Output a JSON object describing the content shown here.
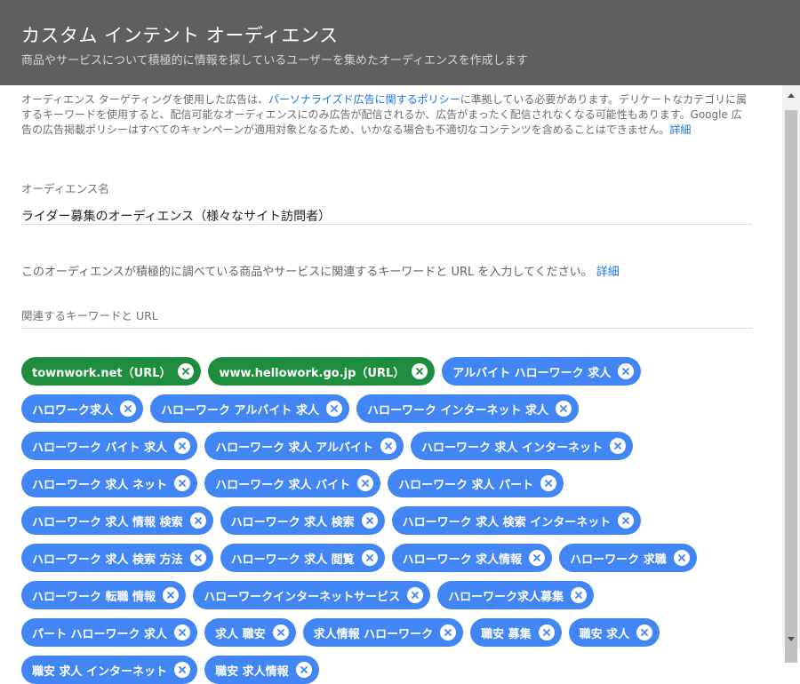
{
  "header": {
    "title": "カスタム インテント オーディエンス",
    "subtitle": "商品やサービスについて積極的に情報を探しているユーザーを集めたオーディエンスを作成します"
  },
  "notice": {
    "part1": "オーディエンス ターゲティングを使用した広告は、",
    "policy_link": "パーソナライズド広告に関するポリシー",
    "part2": "に準拠している必要があります。デリケートなカテゴリに属するキーワードを使用すると、配信可能なオーディエンスにのみ広告が配信されるか、広告がまったく配信されなくなる可能性もあります。Google 広告の広告掲載ポリシーはすべてのキャンペーンが適用対象となるため、いかなる場合も不適切なコンテンツを含めることはできません。",
    "details_link": "詳細"
  },
  "audience_name": {
    "label": "オーディエンス名",
    "value": "ライダー募集のオーディエンス（様々なサイト訪問者）"
  },
  "description": {
    "text": "このオーディエンスが積極的に調べている商品やサービスに関連するキーワードと URL を入力してください。",
    "details_link": "詳細"
  },
  "keywords_field": {
    "label": "関連するキーワードと URL"
  },
  "chips": [
    {
      "label": "townwork.net（URL）",
      "type": "url"
    },
    {
      "label": "www.hellowork.go.jp（URL）",
      "type": "url"
    },
    {
      "label": "アルバイト ハローワーク 求人",
      "type": "keyword"
    },
    {
      "label": "ハロワーク求人",
      "type": "keyword"
    },
    {
      "label": "ハローワーク アルバイト 求人",
      "type": "keyword"
    },
    {
      "label": "ハローワーク インターネット 求人",
      "type": "keyword"
    },
    {
      "label": "ハローワーク バイト 求人",
      "type": "keyword"
    },
    {
      "label": "ハローワーク 求人 アルバイト",
      "type": "keyword"
    },
    {
      "label": "ハローワーク 求人 インターネット",
      "type": "keyword"
    },
    {
      "label": "ハローワーク 求人 ネット",
      "type": "keyword"
    },
    {
      "label": "ハローワーク 求人 バイト",
      "type": "keyword"
    },
    {
      "label": "ハローワーク 求人 パート",
      "type": "keyword"
    },
    {
      "label": "ハローワーク 求人 情報 検索",
      "type": "keyword"
    },
    {
      "label": "ハローワーク 求人 検索",
      "type": "keyword"
    },
    {
      "label": "ハローワーク 求人 検索 インターネット",
      "type": "keyword"
    },
    {
      "label": "ハローワーク 求人 検索 方法",
      "type": "keyword"
    },
    {
      "label": "ハローワーク 求人 閲覧",
      "type": "keyword"
    },
    {
      "label": "ハローワーク 求人情報",
      "type": "keyword"
    },
    {
      "label": "ハローワーク 求職",
      "type": "keyword"
    },
    {
      "label": "ハローワーク 転職 情報",
      "type": "keyword"
    },
    {
      "label": "ハローワークインターネットサービス",
      "type": "keyword"
    },
    {
      "label": "ハローワーク求人募集",
      "type": "keyword"
    },
    {
      "label": "パート ハローワーク 求人",
      "type": "keyword"
    },
    {
      "label": "求人 職安",
      "type": "keyword"
    },
    {
      "label": "求人情報 ハローワーク",
      "type": "keyword"
    },
    {
      "label": "職安 募集",
      "type": "keyword"
    },
    {
      "label": "職安 求人",
      "type": "keyword"
    },
    {
      "label": "職安 求人 インターネット",
      "type": "keyword"
    },
    {
      "label": "職安 求人情報",
      "type": "keyword"
    }
  ],
  "colors": {
    "header_bg": "#5f5f5f",
    "chip_keyword": "#4285f4",
    "chip_url": "#1e8e3e",
    "link": "#1a73e8"
  },
  "icons": {
    "chip_remove": "close-circle-icon",
    "scroll_up": "triangle-up-icon",
    "scroll_down": "triangle-down-icon"
  }
}
